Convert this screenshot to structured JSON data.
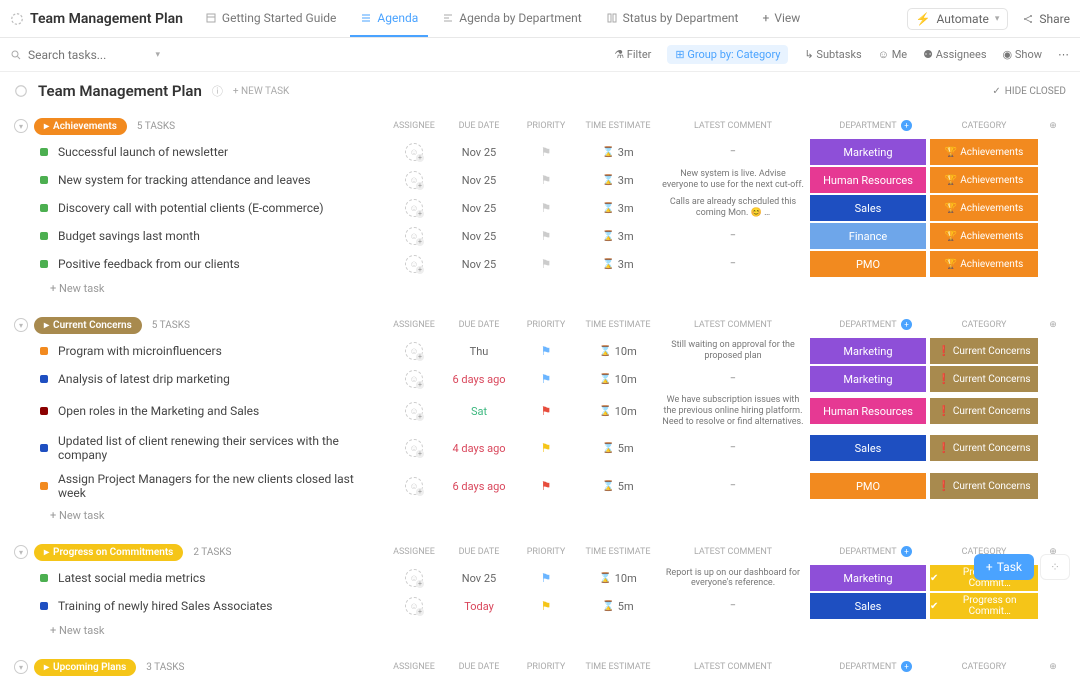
{
  "header": {
    "title": "Team Management Plan",
    "tabs": [
      {
        "label": "Getting Started Guide"
      },
      {
        "label": "Agenda",
        "active": true
      },
      {
        "label": "Agenda by Department"
      },
      {
        "label": "Status by Department"
      },
      {
        "label": "View",
        "add": true
      }
    ],
    "automate": "Automate",
    "share": "Share"
  },
  "search": {
    "placeholder": "Search tasks..."
  },
  "toolbar": {
    "filter": "Filter",
    "group_by": "Group by: Category",
    "subtasks": "Subtasks",
    "me": "Me",
    "assignees": "Assignees",
    "show": "Show"
  },
  "page": {
    "title": "Team Management Plan",
    "new_task": "+ NEW TASK",
    "hide_closed": "HIDE CLOSED"
  },
  "columns": {
    "assignee": "ASSIGNEE",
    "due": "DUE DATE",
    "priority": "PRIORITY",
    "time": "TIME ESTIMATE",
    "comment": "LATEST COMMENT",
    "department": "DEPARTMENT",
    "category": "CATEGORY"
  },
  "newtask_label": "+ New task",
  "groups": [
    {
      "name": "Achievements",
      "color": "#f28a1f",
      "count": "5 TASKS",
      "cat_icon": "🏆",
      "cat_class": "cat-Achievements",
      "cat_text": "Achievements",
      "tasks": [
        {
          "dot": "#4caf50",
          "name": "Successful launch of newsletter",
          "due": "Nov 25",
          "due_class": "",
          "flag": "grey-flag",
          "time": "3m",
          "comment": "–",
          "dept": "Marketing",
          "dept_class": "dept-Marketing"
        },
        {
          "dot": "#4caf50",
          "name": "New system for tracking attendance and leaves",
          "due": "Nov 25",
          "due_class": "",
          "flag": "grey-flag",
          "time": "3m",
          "comment": "New system is live. Advise everyone to use for the next cut-off.",
          "dept": "Human Resources",
          "dept_class": "dept-HumanResources"
        },
        {
          "dot": "#4caf50",
          "name": "Discovery call with potential clients (E-commerce)",
          "due": "Nov 25",
          "due_class": "",
          "flag": "grey-flag",
          "time": "3m",
          "comment": "Calls are already scheduled this coming Mon. 😊 …",
          "dept": "Sales",
          "dept_class": "dept-Sales"
        },
        {
          "dot": "#4caf50",
          "name": "Budget savings last month",
          "due": "Nov 25",
          "due_class": "",
          "flag": "grey-flag",
          "time": "3m",
          "comment": "–",
          "dept": "Finance",
          "dept_class": "dept-Finance"
        },
        {
          "dot": "#4caf50",
          "name": "Positive feedback from our clients",
          "due": "Nov 25",
          "due_class": "",
          "flag": "grey-flag",
          "time": "3m",
          "comment": "–",
          "dept": "PMO",
          "dept_class": "dept-PMO"
        }
      ]
    },
    {
      "name": "Current Concerns",
      "color": "#a88a4e",
      "count": "5 TASKS",
      "cat_icon": "❗",
      "cat_class": "cat-CurrentConcerns",
      "cat_text": "Current Concerns",
      "tasks": [
        {
          "dot": "#f28a1f",
          "name": "Program with microinfluencers",
          "due": "Thu",
          "due_class": "",
          "flag": "blue-flag",
          "time": "10m",
          "comment": "Still waiting on approval for the proposed plan",
          "dept": "Marketing",
          "dept_class": "dept-Marketing"
        },
        {
          "dot": "#1e4fc1",
          "name": "Analysis of latest drip marketing",
          "due": "6 days ago",
          "due_class": "red-date",
          "flag": "blue-flag",
          "time": "10m",
          "comment": "–",
          "dept": "Marketing",
          "dept_class": "dept-Marketing"
        },
        {
          "dot": "#8b0000",
          "name": "Open roles in the Marketing and Sales",
          "due": "Sat",
          "due_class": "green-date",
          "flag": "red-flag",
          "time": "10m",
          "comment": "We have subscription issues with the previous online hiring platform. Need to resolve or find alternatives.",
          "dept": "Human Resources",
          "dept_class": "dept-HumanResources"
        },
        {
          "dot": "#1e4fc1",
          "name": "Updated list of client renewing their services with the company",
          "due": "4 days ago",
          "due_class": "red-date",
          "flag": "yellow-flag",
          "time": "5m",
          "comment": "–",
          "dept": "Sales",
          "dept_class": "dept-Sales"
        },
        {
          "dot": "#f28a1f",
          "name": "Assign Project Managers for the new clients closed last week",
          "due": "6 days ago",
          "due_class": "red-date",
          "flag": "red-flag",
          "time": "5m",
          "comment": "–",
          "dept": "PMO",
          "dept_class": "dept-PMO"
        }
      ]
    },
    {
      "name": "Progress on Commitments",
      "color": "#f5c518",
      "count": "2 TASKS",
      "cat_icon": "✔",
      "cat_class": "cat-Progress",
      "cat_text": "Progress on Commit…",
      "tasks": [
        {
          "dot": "#4caf50",
          "name": "Latest social media metrics",
          "due": "Nov 25",
          "due_class": "",
          "flag": "blue-flag",
          "time": "10m",
          "comment": "Report is up on our dashboard for everyone's reference.",
          "dept": "Marketing",
          "dept_class": "dept-Marketing"
        },
        {
          "dot": "#1e4fc1",
          "name": "Training of newly hired Sales Associates",
          "due": "Today",
          "due_class": "red-date",
          "flag": "yellow-flag",
          "time": "5m",
          "comment": "–",
          "dept": "Sales",
          "dept_class": "dept-Sales"
        }
      ]
    },
    {
      "name": "Upcoming Plans",
      "color": "#f5c518",
      "count": "3 TASKS",
      "cat_icon": "",
      "cat_class": "",
      "cat_text": "",
      "tasks": []
    }
  ],
  "fab": {
    "task": "Task"
  }
}
